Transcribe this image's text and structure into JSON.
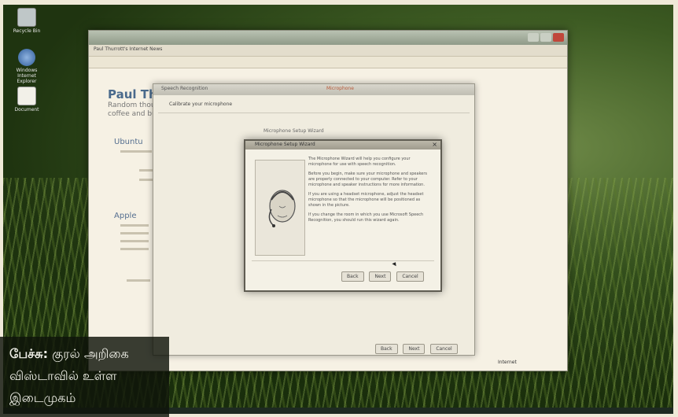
{
  "desktop": {
    "icons": [
      {
        "label": "Recycle Bin",
        "icon": "recycle-bin-icon"
      },
      {
        "label": "Windows Internet Explorer",
        "icon": "internet-explorer-icon"
      },
      {
        "label": "Document",
        "icon": "document-icon"
      }
    ]
  },
  "browser": {
    "tab_title": "Paul Thurrott's Internet News",
    "page_title": "Paul Thurr",
    "page_subtitle_1": "Random thoug",
    "page_subtitle_2": "coffee and bu",
    "blog_heading_1": "Ubuntu",
    "blog_heading_2": "Apple",
    "status_text": "Internet"
  },
  "setup_dialog": {
    "title": "Speech Recognition",
    "title_right": "Microphone",
    "heading": "Calibrate your microphone",
    "caption": "Microphone Setup Wizard",
    "buttons": [
      "Back",
      "Next",
      "Cancel"
    ]
  },
  "wizard": {
    "title": "Microphone Setup Wizard",
    "paragraphs": [
      "The Microphone Wizard will help you configure your microphone for use with speech recognition.",
      "Before you begin, make sure your microphone and speakers are properly connected to your computer. Refer to your microphone and speaker instructions for more information.",
      "If you are using a headset microphone, adjust the headset microphone so that the microphone will be positioned as shown in the picture.",
      "If you change the room in which you use Microsoft Speech Recognition, you should run this wizard again."
    ],
    "buttons": [
      "Back",
      "Next",
      "Cancel"
    ]
  },
  "caption": {
    "lead": "பேச்சு:",
    "text": "குரல் அறிகை விஸ்டாவில் உள்ள இடைமுகம்"
  },
  "colors": {
    "title_blue": "#4a6a8c",
    "close_red": "#c0473a",
    "caption_bg": "#0f140a"
  }
}
